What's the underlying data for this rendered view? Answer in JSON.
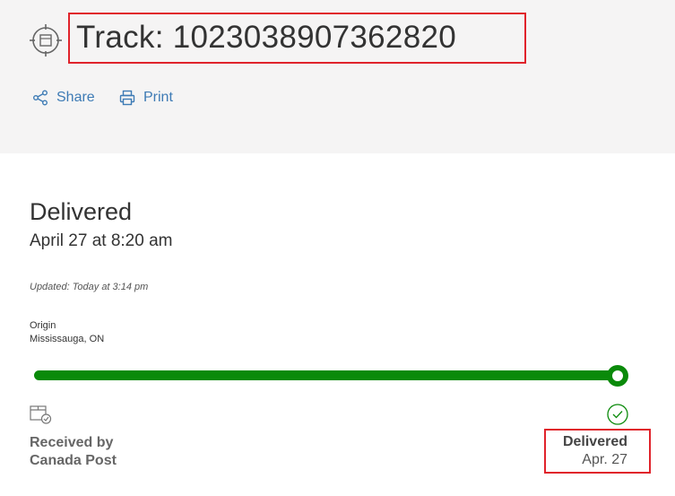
{
  "header": {
    "title": "Track: 1023038907362820",
    "actions": {
      "share": "Share",
      "print": "Print"
    }
  },
  "status": {
    "headline": "Delivered",
    "time": "April 27 at 8:20 am",
    "updated": "Updated: Today at 3:14 pm"
  },
  "origin": {
    "label": "Origin",
    "value": "Mississauga, ON"
  },
  "progress": {
    "fraction": 1.0,
    "color": "#0a8a0a"
  },
  "milestones": {
    "start": {
      "line1": "Received by",
      "line2": "Canada Post",
      "icon": "package-check-icon"
    },
    "end": {
      "label": "Delivered",
      "date": "Apr. 27",
      "icon": "check-circle-icon"
    }
  },
  "colors": {
    "link": "#3e7bb5",
    "highlight": "#e0232b",
    "header_bg": "#f5f4f4"
  }
}
